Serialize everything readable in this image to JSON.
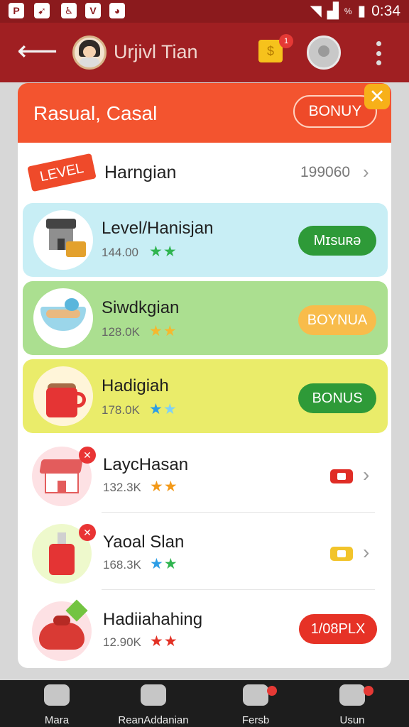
{
  "status_bar": {
    "time": "0:34",
    "signal_label": "%",
    "left_icons": [
      "P",
      "➹",
      "♿",
      "V",
      "◕"
    ]
  },
  "app_bar": {
    "title": "Urjivl Tian",
    "shop_badge_count": "1",
    "shop_label": "$"
  },
  "modal": {
    "title": "Rasual, Casal",
    "bonus_button": "BONUY",
    "close_icon": "✕",
    "level": {
      "badge": "LEVEL",
      "name": "Harngian",
      "value": "199060"
    },
    "items": [
      {
        "name": "Level/Hanisjan",
        "count": "144.00",
        "stars": "★★",
        "star_colors": [
          "#2fb44f",
          "#2fb44f"
        ],
        "action": "Mɪsuʀə",
        "action_style": "green",
        "bg": "#c8eef5"
      },
      {
        "name": "Siwdkgian",
        "count": "128.0K",
        "stars": "★★",
        "star_colors": [
          "#f5b82e",
          "#f5b82e"
        ],
        "action": "BOYNUA",
        "action_style": "orange",
        "bg": "#abdf90"
      },
      {
        "name": "Hadigiah",
        "count": "178.0K",
        "stars": "★★",
        "star_colors": [
          "#2b9de6",
          "#7fd1f5"
        ],
        "action": "BONUS",
        "action_style": "green",
        "bg": "#eaec6a"
      },
      {
        "name": "LaycHasan",
        "count": "132.3K",
        "stars": "★★",
        "star_colors": [
          "#f39a1a",
          "#f39a1a"
        ],
        "action_style": "red-chip"
      },
      {
        "name": "Yaoal Slan",
        "count": "168.3K",
        "stars": "★★",
        "star_colors": [
          "#2b9de6",
          "#2fb44f"
        ],
        "action_style": "yellow-chip"
      },
      {
        "name": "Hadiiahahing",
        "count": "12.90K",
        "stars": "★★",
        "star_colors": [
          "#e23125",
          "#e23125"
        ],
        "action": "1/08PLX",
        "action_style": "red"
      }
    ]
  },
  "bottom_nav": [
    {
      "label": "Mara"
    },
    {
      "label": "ReanAddanian"
    },
    {
      "label": "Fersb"
    },
    {
      "label": "Usun"
    }
  ],
  "colors": {
    "app_bar": "#a01f22",
    "modal_header": "#f3542f",
    "accent_green": "#2e9a38",
    "accent_orange": "#f8bc4b",
    "accent_red": "#e63226"
  }
}
